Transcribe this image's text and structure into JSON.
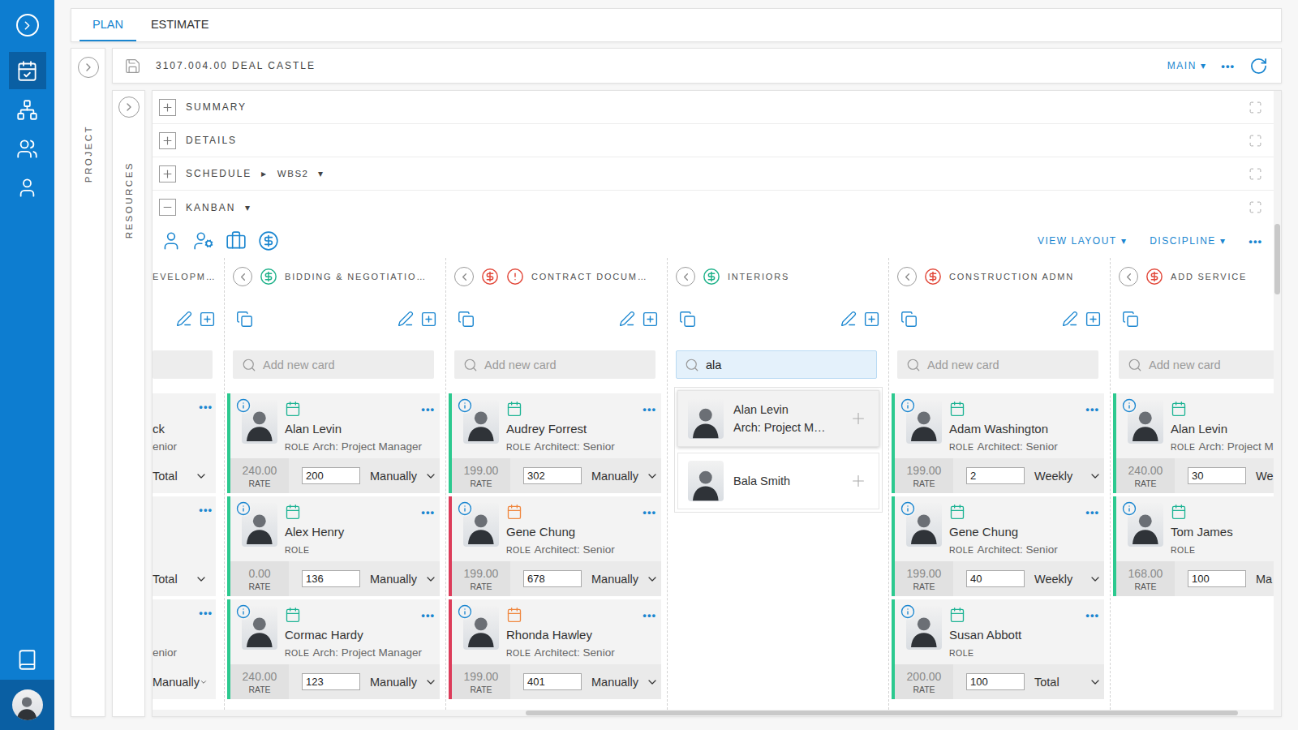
{
  "sidebar": {
    "items": [
      {
        "kind": "toggle",
        "selected": false
      },
      {
        "kind": "plan",
        "selected": true
      },
      {
        "kind": "structure",
        "selected": false
      },
      {
        "kind": "team",
        "selected": false
      },
      {
        "kind": "person",
        "selected": false
      }
    ],
    "bottom_items": [
      {
        "kind": "guide",
        "selected": false
      }
    ],
    "user": {
      "selected": true
    }
  },
  "tabs": [
    {
      "label": "PLAN",
      "selected": true
    },
    {
      "label": "ESTIMATE",
      "selected": false
    }
  ],
  "project_panel": {
    "label": "PROJECT",
    "expanded": false
  },
  "header": {
    "title": "3107.004.00 DEAL CASTLE",
    "view": "MAIN",
    "view_arrow": "▾",
    "more": "•••"
  },
  "resources_panel": {
    "label": "RESOURCES",
    "expanded": false
  },
  "sections": [
    {
      "label": "SUMMARY",
      "expanded": false,
      "crumbs": []
    },
    {
      "label": "DETAILS",
      "expanded": false,
      "crumbs": []
    },
    {
      "label": "SCHEDULE",
      "expanded": false,
      "crumbs": [
        "▸",
        "WBS2",
        "▾"
      ]
    },
    {
      "label": "KANBAN",
      "expanded": true,
      "crumbs": [
        "▾"
      ]
    }
  ],
  "kanban": {
    "tools": [
      {
        "kind": "people"
      },
      {
        "kind": "roles"
      },
      {
        "kind": "projects"
      },
      {
        "kind": "budget"
      }
    ],
    "menus": [
      {
        "label": "VIEW LAYOUT",
        "arrow": "▾"
      },
      {
        "label": "DISCIPLINE",
        "arrow": "▾"
      }
    ],
    "more": "•••",
    "labels": {
      "role": "ROLE",
      "rate": "RATE",
      "more": "•••"
    },
    "columns": [
      {
        "kind": "partial",
        "title": "EVELOPM…",
        "search": {
          "active": false
        },
        "cards": [
          {
            "name": "ck",
            "role": "enior",
            "unit": "Total"
          },
          {
            "unit": "Total"
          },
          {
            "role": "enior",
            "unit": "Manually"
          }
        ]
      },
      {
        "kind": "full",
        "title": "BIDDING & NEGOTIATIO…",
        "budget_color": "#1fb28a",
        "alert": false,
        "search": {
          "placeholder": "Add new card",
          "active": false
        },
        "cards": [
          {
            "name": "Alan Levin",
            "role": "Arch: Project Manager",
            "rate": "240.00",
            "hours": "200",
            "unit": "Manually",
            "color": "#2cc98f",
            "calendar_color": "#1db394"
          },
          {
            "name": "Alex Henry",
            "rate": "0.00",
            "hours": "136",
            "unit": "Manually",
            "color": "#2cc98f",
            "calendar_color": "#1db394"
          },
          {
            "name": "Cormac Hardy",
            "role": "Arch: Project Manager",
            "rate": "240.00",
            "hours": "123",
            "unit": "Manually",
            "color": "#2cc98f",
            "calendar_color": "#1db394"
          }
        ]
      },
      {
        "kind": "full",
        "title": "CONTRACT DOCUM…",
        "budget_color": "#e2493b",
        "alert": true,
        "search": {
          "placeholder": "Add new card",
          "active": false
        },
        "cards": [
          {
            "name": "Audrey Forrest",
            "role": "Architect: Senior",
            "rate": "199.00",
            "hours": "302",
            "unit": "Manually",
            "color": "#2cc98f",
            "calendar_color": "#1db394"
          },
          {
            "name": "Gene Chung",
            "role": "Architect: Senior",
            "rate": "199.00",
            "hours": "678",
            "unit": "Manually",
            "color": "#dc3c5a",
            "calendar_color": "#f0873f"
          },
          {
            "name": "Rhonda Hawley",
            "role": "Architect: Senior",
            "rate": "199.00",
            "hours": "401",
            "unit": "Manually",
            "color": "#dc3c5a",
            "calendar_color": "#f0873f"
          }
        ]
      },
      {
        "kind": "full",
        "title": "INTERIORS",
        "budget_color": "#1fb28a",
        "alert": false,
        "search": {
          "placeholder": "Add new card",
          "value": "ala",
          "active": true
        },
        "results": [
          {
            "name": "Alan Levin",
            "role": "Arch: Project M…",
            "selected": true
          },
          {
            "name": "Bala Smith",
            "selected": false
          }
        ],
        "cards": []
      },
      {
        "kind": "full",
        "title": "CONSTRUCTION ADMN",
        "budget_color": "#e2493b",
        "alert": false,
        "search": {
          "placeholder": "Add new card",
          "active": false
        },
        "cards": [
          {
            "name": "Adam Washington",
            "role": "Architect: Senior",
            "rate": "199.00",
            "hours": "2",
            "unit": "Weekly",
            "color": "#2cc98f",
            "calendar_color": "#1db394"
          },
          {
            "name": "Gene Chung",
            "role": "Architect: Senior",
            "rate": "199.00",
            "hours": "40",
            "unit": "Weekly",
            "color": "#2cc98f",
            "calendar_color": "#1db394"
          },
          {
            "name": "Susan Abbott",
            "rate": "200.00",
            "hours": "100",
            "unit": "Total",
            "color": "#2cc98f",
            "calendar_color": "#1db394"
          }
        ]
      },
      {
        "kind": "full",
        "title": "ADD SERVICE",
        "budget_color": "#e2493b",
        "alert": false,
        "search": {
          "placeholder": "Add new card",
          "active": false
        },
        "cards": [
          {
            "name": "Alan Levin",
            "role": "Arch: Project M",
            "rate": "240.00",
            "hours": "30",
            "unit": "We",
            "color": "#2cc98f",
            "calendar_color": "#1db394"
          },
          {
            "name": "Tom James",
            "rate": "168.00",
            "hours": "100",
            "unit": "Ma",
            "color": "#2cc98f",
            "calendar_color": "#1db394"
          }
        ]
      }
    ]
  },
  "scrollbars": {
    "horizontal": {
      "offset": 0.333,
      "level": 0.635
    },
    "vertical": {
      "offset": 0.213,
      "level": 0.112
    }
  }
}
